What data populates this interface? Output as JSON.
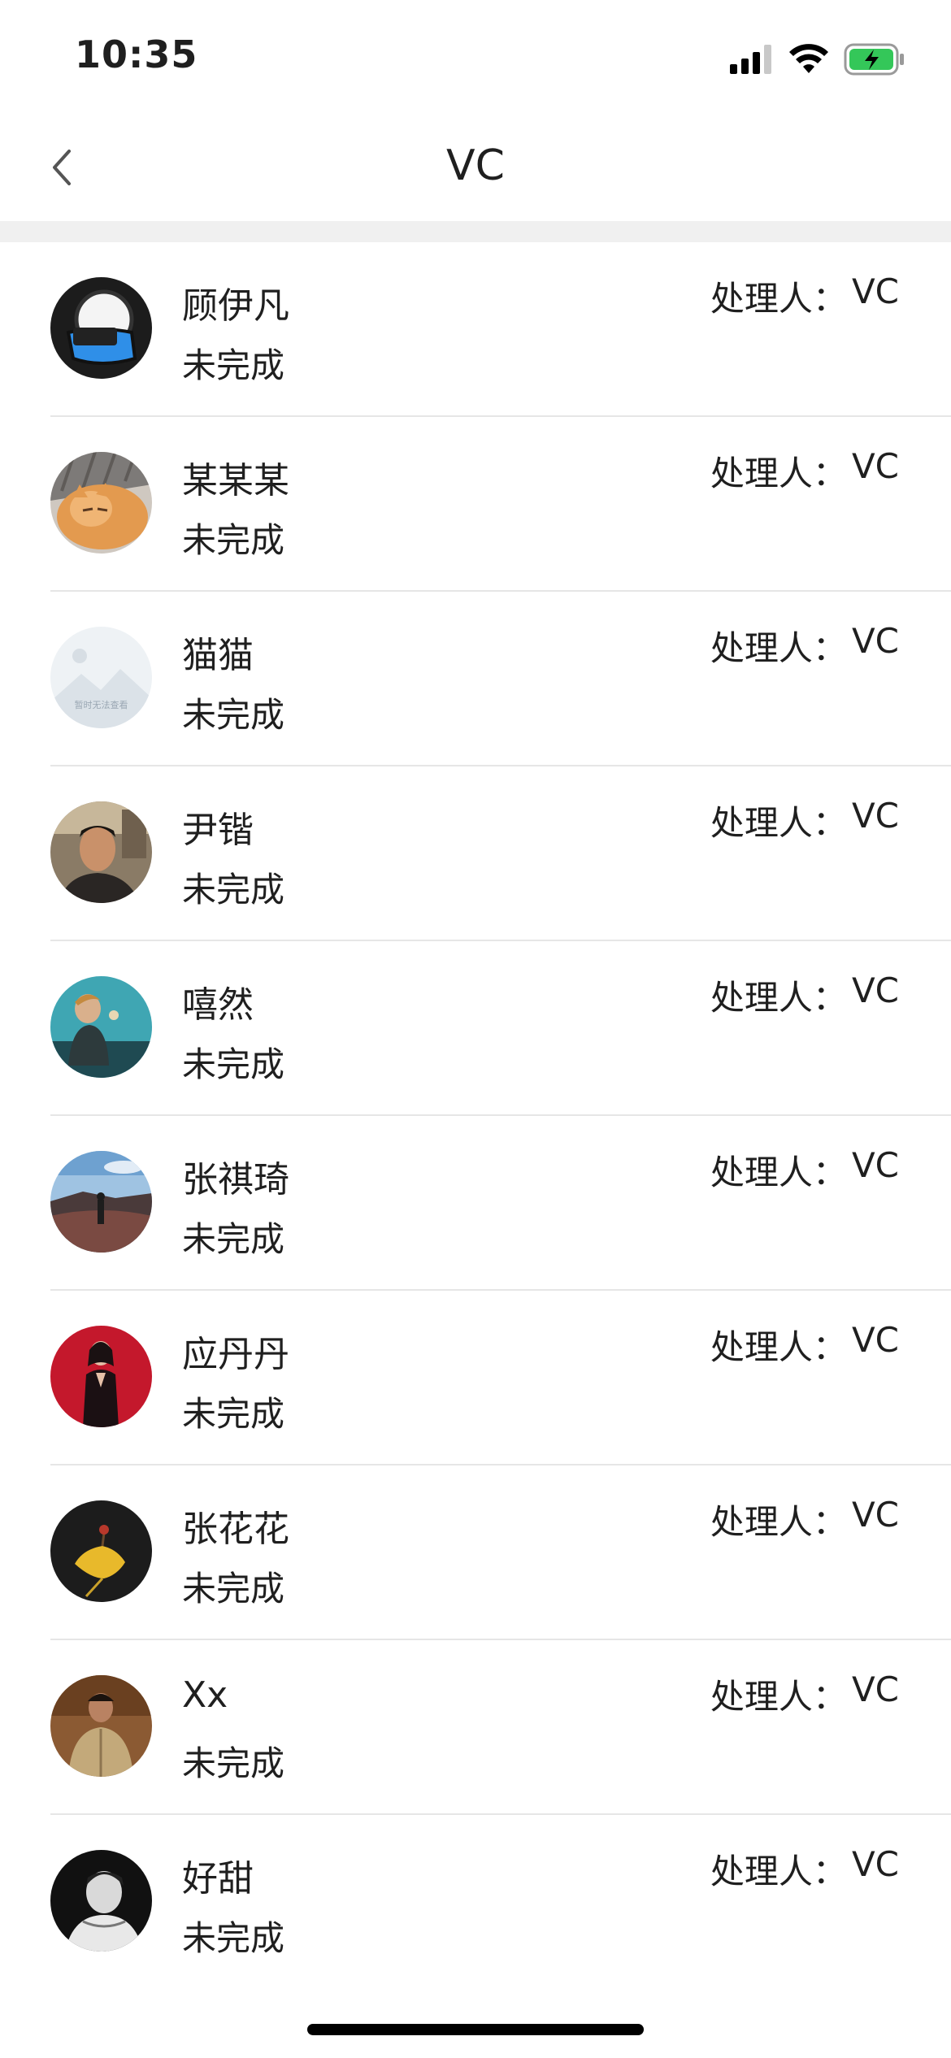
{
  "status_bar": {
    "time": "10:35",
    "icons": [
      "signal-icon",
      "wifi-icon",
      "battery-charging-icon"
    ],
    "battery_color": "#34c759"
  },
  "nav": {
    "title": "VC",
    "back_icon": "chevron-left-icon"
  },
  "list": {
    "handler_label": "处理人：",
    "items": [
      {
        "name": "顾伊凡",
        "status": "未完成",
        "handler": "VC",
        "avatar": "avatar-dark-robot"
      },
      {
        "name": "某某某",
        "status": "未完成",
        "handler": "VC",
        "avatar": "avatar-cat"
      },
      {
        "name": "猫猫",
        "status": "未完成",
        "handler": "VC",
        "avatar": "avatar-placeholder",
        "avatar_caption": "暂时无法查看"
      },
      {
        "name": "尹锴",
        "status": "未完成",
        "handler": "VC",
        "avatar": "avatar-portrait-man"
      },
      {
        "name": "嘻然",
        "status": "未完成",
        "handler": "VC",
        "avatar": "avatar-boy-teal"
      },
      {
        "name": "张祺琦",
        "status": "未完成",
        "handler": "VC",
        "avatar": "avatar-landscape"
      },
      {
        "name": "应丹丹",
        "status": "未完成",
        "handler": "VC",
        "avatar": "avatar-woman-red"
      },
      {
        "name": "张花花",
        "status": "未完成",
        "handler": "VC",
        "avatar": "avatar-ginkgo-leaf"
      },
      {
        "name": "Xx",
        "status": "未完成",
        "handler": "VC",
        "avatar": "avatar-man-khaki"
      },
      {
        "name": "好甜",
        "status": "未完成",
        "handler": "VC",
        "avatar": "avatar-bw-portrait"
      }
    ]
  },
  "colors": {
    "background": "#ffffff",
    "separator": "#e6e6e6",
    "band": "#f0f0f0",
    "text": "#1f1f1f"
  }
}
